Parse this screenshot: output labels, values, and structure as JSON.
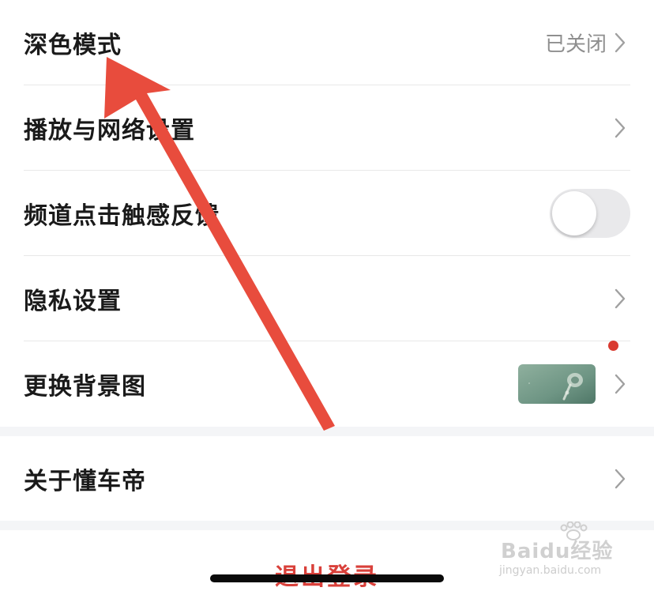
{
  "settings": {
    "dark_mode": {
      "label": "深色模式",
      "value": "已关闭"
    },
    "playback_network": {
      "label": "播放与网络设置"
    },
    "haptic_feedback": {
      "label": "频道点击触感反馈",
      "enabled": false
    },
    "privacy": {
      "label": "隐私设置"
    },
    "background_image": {
      "label": "更换背景图",
      "has_new_badge": true
    },
    "about": {
      "label": "关于懂车帝"
    }
  },
  "logout": {
    "label": "退出登录"
  },
  "watermark": {
    "brand": "Baidu经验",
    "url": "jingyan.baidu.com"
  },
  "colors": {
    "accent_red": "#d9403a",
    "annotation_arrow": "#e84c3d",
    "badge_dot": "#d93a30"
  },
  "icons": [
    "chevron-right-icon",
    "red-arrow-annotation"
  ]
}
